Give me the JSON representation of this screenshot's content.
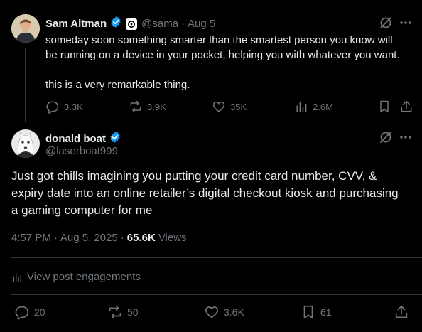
{
  "reply_parent": {
    "author_name": "Sam Altman",
    "handle": "@sama",
    "separator": "·",
    "date": "Aug 5",
    "text_line1": "someday soon something smarter than the smartest person you know will",
    "text_line2": "be running on a device in your pocket, helping you with whatever you want.",
    "text_line3": "this is a very remarkable thing.",
    "actions": {
      "replies": "3.3K",
      "reposts": "3.9K",
      "likes": "35K",
      "views": "2.6M"
    }
  },
  "focus_tweet": {
    "author_name": "donald boat",
    "handle": "@laserboat999",
    "text_line1": "Just got chills imagining you putting your credit card number, CVV, &",
    "text_line2": "expiry date into an online retailer’s digital checkout kiosk and purchasing",
    "text_line3": "a gaming computer for me",
    "time": "4:57 PM",
    "separator1": "·",
    "date": "Aug 5, 2025",
    "separator2": "·",
    "views_count": "65.6K",
    "views_label": "Views",
    "engagements_link": "View post engagements",
    "actions": {
      "replies": "20",
      "reposts": "50",
      "likes": "3.6K",
      "bookmarks": "61"
    }
  },
  "colors": {
    "background": "#000000",
    "text_primary": "#e7e9ea",
    "text_muted": "#71767b",
    "verified_blue": "#1d9bf0",
    "divider": "#2f3336"
  },
  "icons": [
    "grok-icon",
    "more-icon",
    "verified-badge-icon",
    "affiliate-badge-icon",
    "reply-icon",
    "repost-icon",
    "like-icon",
    "views-icon",
    "bookmark-icon",
    "share-icon"
  ]
}
